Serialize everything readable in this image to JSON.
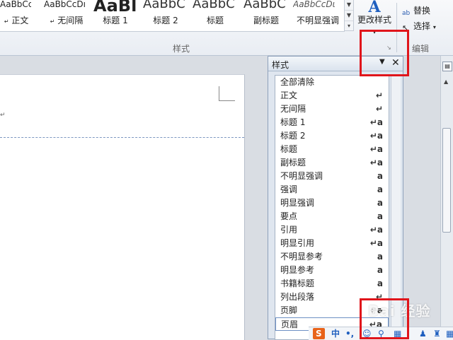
{
  "ribbon": {
    "gallery": [
      {
        "sample": "AaBbCcDı",
        "name": "正文"
      },
      {
        "sample": "AaBbCcDı",
        "name": "无间隔"
      },
      {
        "sample": "AaBl",
        "name": "标题 1"
      },
      {
        "sample": "AaBbC",
        "name": "标题 2"
      },
      {
        "sample": "AaBbC",
        "name": "标题"
      },
      {
        "sample": "AaBbC",
        "name": "副标题"
      },
      {
        "sample": "AaBbCcDι",
        "name": "不明显强调"
      }
    ],
    "change_style_label": "更改样式",
    "styles_group_label": "样式",
    "replace_label": "替换",
    "select_label": "选择",
    "edit_group_label": "编辑"
  },
  "styles_pane": {
    "title": "样式",
    "items": [
      {
        "name": "全部清除",
        "icon": ""
      },
      {
        "name": "正文",
        "icon": "↵"
      },
      {
        "name": "无间隔",
        "icon": "↵"
      },
      {
        "name": "标题 1",
        "icon": "↵a"
      },
      {
        "name": "标题 2",
        "icon": "↵a"
      },
      {
        "name": "标题",
        "icon": "↵a"
      },
      {
        "name": "副标题",
        "icon": "↵a"
      },
      {
        "name": "不明显强调",
        "icon": "a"
      },
      {
        "name": "强调",
        "icon": "a"
      },
      {
        "name": "明显强调",
        "icon": "a"
      },
      {
        "name": "要点",
        "icon": "a"
      },
      {
        "name": "引用",
        "icon": "↵a"
      },
      {
        "name": "明显引用",
        "icon": "↵a"
      },
      {
        "name": "不明显参考",
        "icon": "a"
      },
      {
        "name": "明显参考",
        "icon": "a"
      },
      {
        "name": "书籍标题",
        "icon": "a"
      },
      {
        "name": "列出段落",
        "icon": "↵"
      },
      {
        "name": "页脚",
        "icon": "↵a"
      },
      {
        "name": "页眉",
        "icon": "↵a"
      }
    ],
    "selected_index": 18
  },
  "ime": {
    "s_icon": "S",
    "lang": "中",
    "punct": "•,"
  },
  "watermark": "Bai 经验",
  "colors": {
    "highlight": "#e0151b",
    "accent": "#1f5fbf"
  }
}
